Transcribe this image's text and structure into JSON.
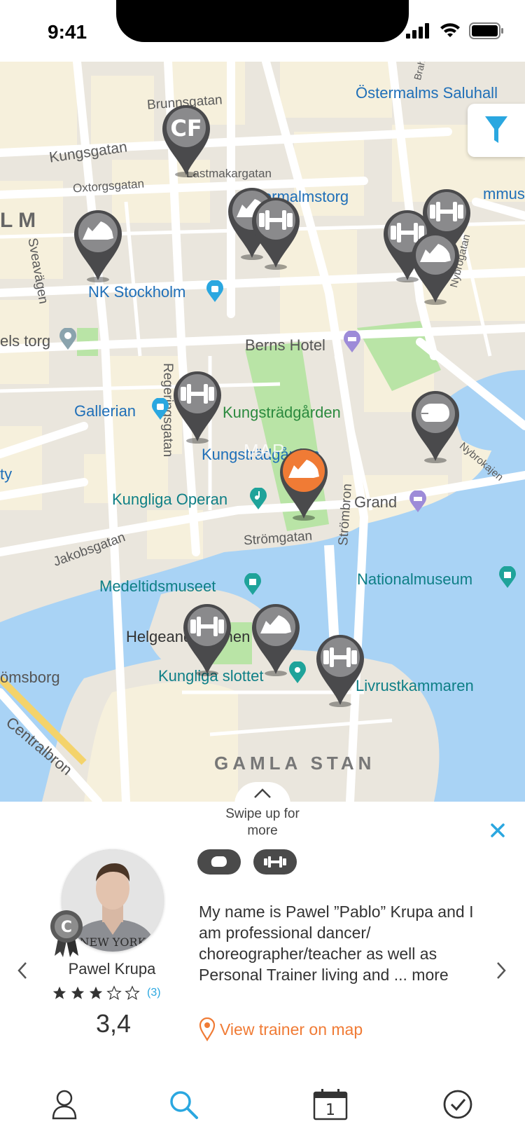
{
  "status_bar": {
    "time": "9:41"
  },
  "map": {
    "watermark": "MAP",
    "labels": {
      "ostermalms": "Östermalms Saluhall",
      "brunnsgatan": "Brunnsgatan",
      "kungsgatan": "Kungsgatan",
      "oxtorgsgatan": "Oxtorgsgatan",
      "lastmakargatan": "Lastmakargatan",
      "normalmstorg": "Normalmstorg",
      "mmuse": "mmuse",
      "lm": "L M",
      "sveavagen": "Sveavägen",
      "nk": "NK Stockholm",
      "els_torg": "els torg",
      "berns": "Berns Hotel",
      "gallerian": "Gallerian",
      "kungstradgarden": "Kungsträdgården",
      "kungstrad_station": "Kungsträdgården",
      "regeringsgatan": "Regeringsgatan",
      "ty": "ty",
      "operan": "Kungliga Operan",
      "grand": "Grand",
      "jakobsgatan": "Jakobsgatan",
      "stromgatan": "Strömgatan",
      "strombron": "Strömbron",
      "medeltidsmuseet": "Medeltidsmuseet",
      "nationalmuseum": "Nationalmuseum",
      "helgeandsholmen": "Helgeandsholmen",
      "slottet": "Kungliga slottet",
      "livrustkammaren": "Livrustkammaren",
      "omsborg": "ömsborg",
      "centralbron": "Centralbron",
      "gamla_stan": "GAMLA STAN",
      "nybrogatan": "Nybrogatan",
      "nybrokajen": "Nybrokajen",
      "brahe": "Brahe"
    },
    "pins": [
      {
        "icon": "crossfit-cf-icon",
        "text": "CF",
        "active": false
      },
      {
        "icon": "sneaker-icon",
        "active": false
      },
      {
        "icon": "sneaker-icon",
        "active": false
      },
      {
        "icon": "dumbbell-icon",
        "active": false
      },
      {
        "icon": "dumbbell-icon",
        "active": false
      },
      {
        "icon": "dumbbell-icon",
        "active": false
      },
      {
        "icon": "sneaker-icon",
        "active": false
      },
      {
        "icon": "dumbbell-icon",
        "active": false
      },
      {
        "icon": "boxing-glove-icon",
        "active": false
      },
      {
        "icon": "sneaker-icon",
        "active": true
      },
      {
        "icon": "dumbbell-icon",
        "active": false
      },
      {
        "icon": "sneaker-icon",
        "active": false
      },
      {
        "icon": "dumbbell-icon",
        "active": false
      }
    ],
    "colors": {
      "pin": "#4a4a4c",
      "pin_active": "#f07b35",
      "water": "#a9d3f5",
      "park": "#b9e4a6",
      "block": "#f7f1de"
    }
  },
  "filter": {
    "icon": "filter-icon",
    "color": "#2aa7e0"
  },
  "sheet": {
    "swipe_hint": "Swipe up for more",
    "trainer": {
      "name": "Pawel Krupa",
      "badge": "C",
      "stars": 3,
      "max_stars": 5,
      "rating_count": "(3)",
      "rating_value": "3,4",
      "tags": [
        "boxing-glove-icon",
        "dumbbell-icon"
      ],
      "bio": "My name is Pawel ”Pablo” Krupa and I am professional dancer/ choreographer/teacher as well as Personal Trainer living and ...",
      "more_link": "more",
      "view_map": "View trainer on map"
    }
  },
  "tabbar": {
    "items": [
      {
        "icon": "profile-icon"
      },
      {
        "icon": "search-icon",
        "active": true
      },
      {
        "icon": "calendar-icon",
        "day": "1"
      },
      {
        "icon": "checkmark-circle-icon"
      }
    ],
    "active_color": "#2aa7e0"
  }
}
